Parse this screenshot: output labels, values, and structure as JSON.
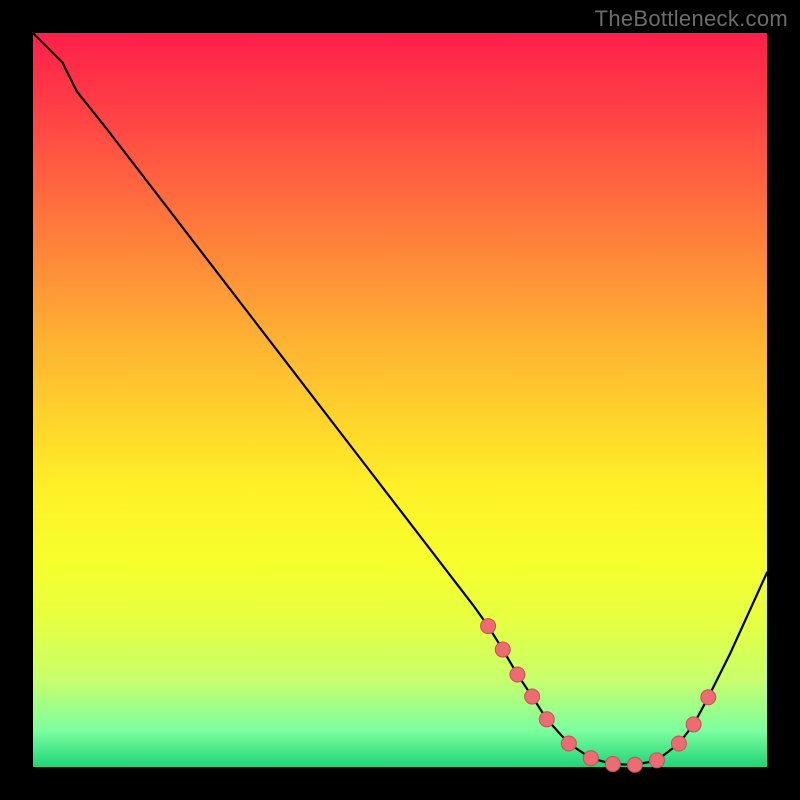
{
  "watermark": "TheBottleneck.com",
  "colors": {
    "frame": "#000000",
    "curve_stroke": "#000000",
    "marker_fill": "#ed6b72",
    "marker_stroke": "#c94f56"
  },
  "chart_data": {
    "type": "line",
    "title": "",
    "xlabel": "",
    "ylabel": "",
    "xlim": [
      0,
      100
    ],
    "ylim": [
      0,
      100
    ],
    "grid": false,
    "legend": false,
    "annotations": [],
    "series": [
      {
        "name": "bottleneck-curve",
        "x": [
          0,
          4,
          6,
          10,
          15,
          20,
          25,
          30,
          35,
          40,
          45,
          50,
          55,
          60,
          62,
          64,
          66,
          68,
          70,
          73,
          76,
          79,
          82,
          85,
          88,
          90,
          92,
          95,
          100
        ],
        "y": [
          100,
          96,
          92,
          87,
          80.5,
          74,
          67.5,
          61,
          54.5,
          48,
          41.5,
          35,
          28.5,
          22,
          19.2,
          16,
          12.6,
          9.6,
          6.5,
          3.2,
          1.2,
          0.4,
          0.3,
          0.9,
          3.2,
          5.8,
          9.5,
          15.5,
          26.5
        ]
      }
    ],
    "markers": {
      "name": "highlight-points",
      "x": [
        62,
        64,
        66,
        68,
        70,
        73,
        76,
        79,
        82,
        85,
        88,
        90,
        92
      ],
      "y": [
        19.2,
        16,
        12.6,
        9.6,
        6.5,
        3.2,
        1.2,
        0.4,
        0.3,
        0.9,
        3.2,
        5.8,
        9.5
      ]
    }
  }
}
